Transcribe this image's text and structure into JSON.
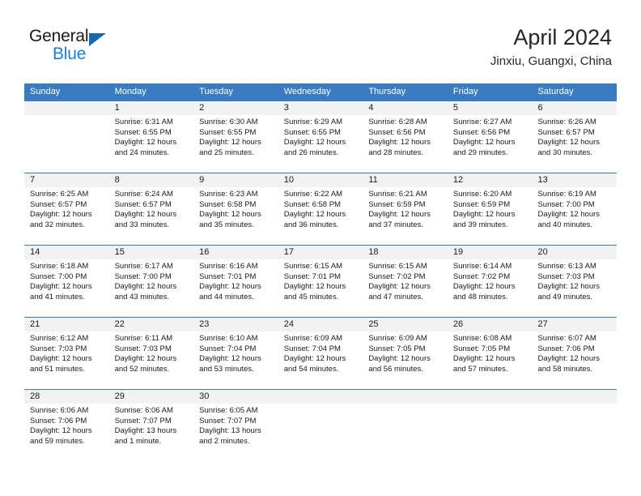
{
  "brand": {
    "name_part1": "General",
    "name_part2": "Blue"
  },
  "header": {
    "title": "April 2024",
    "subtitle": "Jinxiu, Guangxi, China"
  },
  "colors": {
    "header_blue": "#3a7cc0",
    "logo_blue": "#1b7fd4",
    "daynum_band": "#f2f2f2"
  },
  "weekdays": [
    "Sunday",
    "Monday",
    "Tuesday",
    "Wednesday",
    "Thursday",
    "Friday",
    "Saturday"
  ],
  "weeks": [
    [
      {
        "day": "",
        "sunrise": "",
        "sunset": "",
        "daylight_line1": "",
        "daylight_line2": ""
      },
      {
        "day": "1",
        "sunrise": "Sunrise: 6:31 AM",
        "sunset": "Sunset: 6:55 PM",
        "daylight_line1": "Daylight: 12 hours",
        "daylight_line2": "and 24 minutes."
      },
      {
        "day": "2",
        "sunrise": "Sunrise: 6:30 AM",
        "sunset": "Sunset: 6:55 PM",
        "daylight_line1": "Daylight: 12 hours",
        "daylight_line2": "and 25 minutes."
      },
      {
        "day": "3",
        "sunrise": "Sunrise: 6:29 AM",
        "sunset": "Sunset: 6:55 PM",
        "daylight_line1": "Daylight: 12 hours",
        "daylight_line2": "and 26 minutes."
      },
      {
        "day": "4",
        "sunrise": "Sunrise: 6:28 AM",
        "sunset": "Sunset: 6:56 PM",
        "daylight_line1": "Daylight: 12 hours",
        "daylight_line2": "and 28 minutes."
      },
      {
        "day": "5",
        "sunrise": "Sunrise: 6:27 AM",
        "sunset": "Sunset: 6:56 PM",
        "daylight_line1": "Daylight: 12 hours",
        "daylight_line2": "and 29 minutes."
      },
      {
        "day": "6",
        "sunrise": "Sunrise: 6:26 AM",
        "sunset": "Sunset: 6:57 PM",
        "daylight_line1": "Daylight: 12 hours",
        "daylight_line2": "and 30 minutes."
      }
    ],
    [
      {
        "day": "7",
        "sunrise": "Sunrise: 6:25 AM",
        "sunset": "Sunset: 6:57 PM",
        "daylight_line1": "Daylight: 12 hours",
        "daylight_line2": "and 32 minutes."
      },
      {
        "day": "8",
        "sunrise": "Sunrise: 6:24 AM",
        "sunset": "Sunset: 6:57 PM",
        "daylight_line1": "Daylight: 12 hours",
        "daylight_line2": "and 33 minutes."
      },
      {
        "day": "9",
        "sunrise": "Sunrise: 6:23 AM",
        "sunset": "Sunset: 6:58 PM",
        "daylight_line1": "Daylight: 12 hours",
        "daylight_line2": "and 35 minutes."
      },
      {
        "day": "10",
        "sunrise": "Sunrise: 6:22 AM",
        "sunset": "Sunset: 6:58 PM",
        "daylight_line1": "Daylight: 12 hours",
        "daylight_line2": "and 36 minutes."
      },
      {
        "day": "11",
        "sunrise": "Sunrise: 6:21 AM",
        "sunset": "Sunset: 6:59 PM",
        "daylight_line1": "Daylight: 12 hours",
        "daylight_line2": "and 37 minutes."
      },
      {
        "day": "12",
        "sunrise": "Sunrise: 6:20 AM",
        "sunset": "Sunset: 6:59 PM",
        "daylight_line1": "Daylight: 12 hours",
        "daylight_line2": "and 39 minutes."
      },
      {
        "day": "13",
        "sunrise": "Sunrise: 6:19 AM",
        "sunset": "Sunset: 7:00 PM",
        "daylight_line1": "Daylight: 12 hours",
        "daylight_line2": "and 40 minutes."
      }
    ],
    [
      {
        "day": "14",
        "sunrise": "Sunrise: 6:18 AM",
        "sunset": "Sunset: 7:00 PM",
        "daylight_line1": "Daylight: 12 hours",
        "daylight_line2": "and 41 minutes."
      },
      {
        "day": "15",
        "sunrise": "Sunrise: 6:17 AM",
        "sunset": "Sunset: 7:00 PM",
        "daylight_line1": "Daylight: 12 hours",
        "daylight_line2": "and 43 minutes."
      },
      {
        "day": "16",
        "sunrise": "Sunrise: 6:16 AM",
        "sunset": "Sunset: 7:01 PM",
        "daylight_line1": "Daylight: 12 hours",
        "daylight_line2": "and 44 minutes."
      },
      {
        "day": "17",
        "sunrise": "Sunrise: 6:15 AM",
        "sunset": "Sunset: 7:01 PM",
        "daylight_line1": "Daylight: 12 hours",
        "daylight_line2": "and 45 minutes."
      },
      {
        "day": "18",
        "sunrise": "Sunrise: 6:15 AM",
        "sunset": "Sunset: 7:02 PM",
        "daylight_line1": "Daylight: 12 hours",
        "daylight_line2": "and 47 minutes."
      },
      {
        "day": "19",
        "sunrise": "Sunrise: 6:14 AM",
        "sunset": "Sunset: 7:02 PM",
        "daylight_line1": "Daylight: 12 hours",
        "daylight_line2": "and 48 minutes."
      },
      {
        "day": "20",
        "sunrise": "Sunrise: 6:13 AM",
        "sunset": "Sunset: 7:03 PM",
        "daylight_line1": "Daylight: 12 hours",
        "daylight_line2": "and 49 minutes."
      }
    ],
    [
      {
        "day": "21",
        "sunrise": "Sunrise: 6:12 AM",
        "sunset": "Sunset: 7:03 PM",
        "daylight_line1": "Daylight: 12 hours",
        "daylight_line2": "and 51 minutes."
      },
      {
        "day": "22",
        "sunrise": "Sunrise: 6:11 AM",
        "sunset": "Sunset: 7:03 PM",
        "daylight_line1": "Daylight: 12 hours",
        "daylight_line2": "and 52 minutes."
      },
      {
        "day": "23",
        "sunrise": "Sunrise: 6:10 AM",
        "sunset": "Sunset: 7:04 PM",
        "daylight_line1": "Daylight: 12 hours",
        "daylight_line2": "and 53 minutes."
      },
      {
        "day": "24",
        "sunrise": "Sunrise: 6:09 AM",
        "sunset": "Sunset: 7:04 PM",
        "daylight_line1": "Daylight: 12 hours",
        "daylight_line2": "and 54 minutes."
      },
      {
        "day": "25",
        "sunrise": "Sunrise: 6:09 AM",
        "sunset": "Sunset: 7:05 PM",
        "daylight_line1": "Daylight: 12 hours",
        "daylight_line2": "and 56 minutes."
      },
      {
        "day": "26",
        "sunrise": "Sunrise: 6:08 AM",
        "sunset": "Sunset: 7:05 PM",
        "daylight_line1": "Daylight: 12 hours",
        "daylight_line2": "and 57 minutes."
      },
      {
        "day": "27",
        "sunrise": "Sunrise: 6:07 AM",
        "sunset": "Sunset: 7:06 PM",
        "daylight_line1": "Daylight: 12 hours",
        "daylight_line2": "and 58 minutes."
      }
    ],
    [
      {
        "day": "28",
        "sunrise": "Sunrise: 6:06 AM",
        "sunset": "Sunset: 7:06 PM",
        "daylight_line1": "Daylight: 12 hours",
        "daylight_line2": "and 59 minutes."
      },
      {
        "day": "29",
        "sunrise": "Sunrise: 6:06 AM",
        "sunset": "Sunset: 7:07 PM",
        "daylight_line1": "Daylight: 13 hours",
        "daylight_line2": "and 1 minute."
      },
      {
        "day": "30",
        "sunrise": "Sunrise: 6:05 AM",
        "sunset": "Sunset: 7:07 PM",
        "daylight_line1": "Daylight: 13 hours",
        "daylight_line2": "and 2 minutes."
      },
      {
        "day": "",
        "sunrise": "",
        "sunset": "",
        "daylight_line1": "",
        "daylight_line2": ""
      },
      {
        "day": "",
        "sunrise": "",
        "sunset": "",
        "daylight_line1": "",
        "daylight_line2": ""
      },
      {
        "day": "",
        "sunrise": "",
        "sunset": "",
        "daylight_line1": "",
        "daylight_line2": ""
      },
      {
        "day": "",
        "sunrise": "",
        "sunset": "",
        "daylight_line1": "",
        "daylight_line2": ""
      }
    ]
  ]
}
